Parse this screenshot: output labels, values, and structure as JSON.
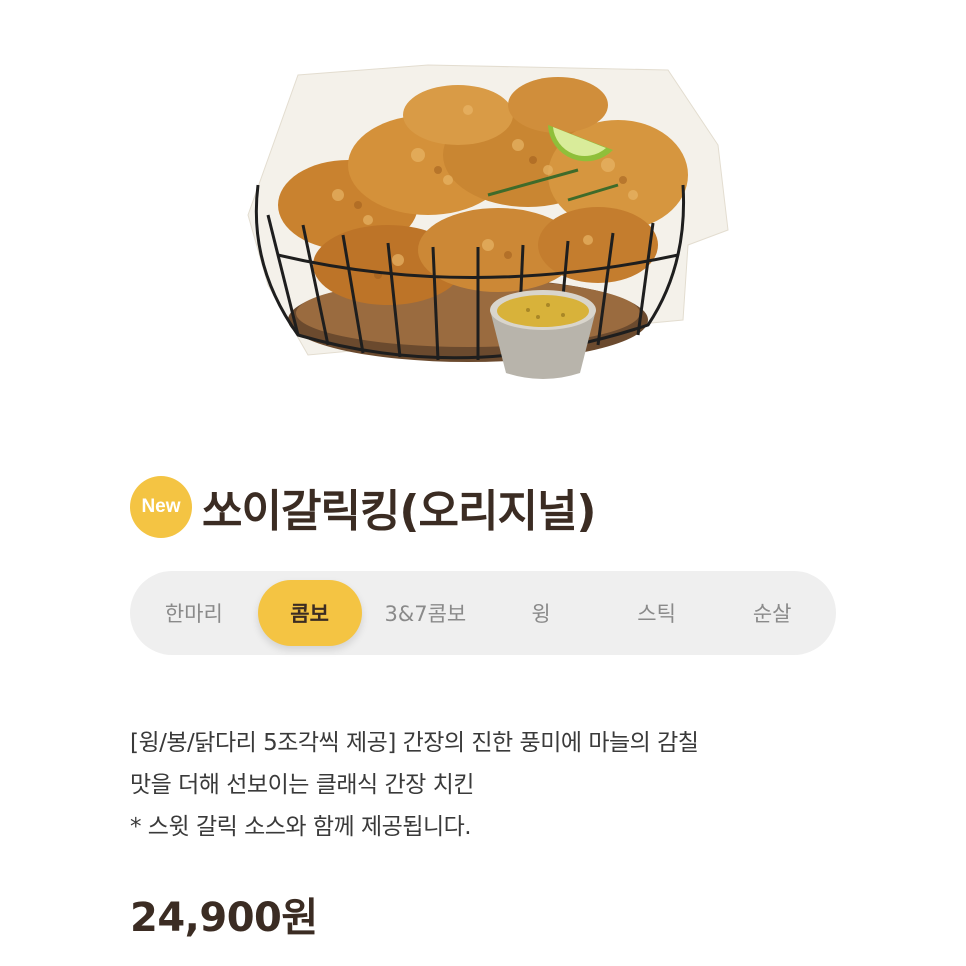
{
  "product": {
    "badge": "New",
    "name": "쏘이갈릭킹(오리지널)",
    "image_icon": "fried-chicken-basket-image"
  },
  "tabs": [
    {
      "label": "한마리",
      "active": false
    },
    {
      "label": "콤보",
      "active": true
    },
    {
      "label": "3&7콤보",
      "active": false
    },
    {
      "label": "윙",
      "active": false
    },
    {
      "label": "스틱",
      "active": false
    },
    {
      "label": "순살",
      "active": false
    }
  ],
  "description": {
    "line1": "[윙/봉/닭다리 5조각씩 제공] 간장의 진한 풍미에 마늘의 감칠",
    "line2": "맛을 더해 선보이는 클래식 간장 치킨",
    "line3": "* 스윗 갈릭 소스와 함께 제공됩니다."
  },
  "price": "24,900원",
  "colors": {
    "accent": "#f4c443",
    "title": "#3b2c23",
    "tab_bg": "#efefef",
    "tab_text": "#8a8a8a"
  }
}
